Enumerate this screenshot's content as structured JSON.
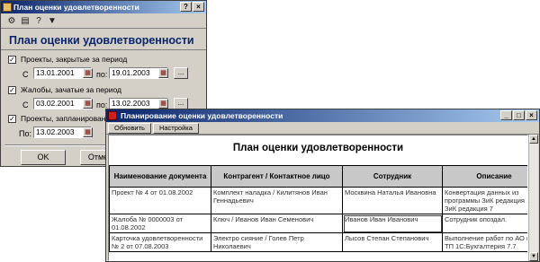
{
  "dialog": {
    "title": "План оценки удовлетворенности",
    "heading": "План оценки удовлетворенности",
    "toolbar_icons": [
      "tools-icon",
      "copy-icon",
      "help-icon",
      "filter-icon"
    ],
    "groups": [
      {
        "checked": true,
        "label": "Проекты, закрытые за период",
        "from_label": "С",
        "from": "13.01.2001",
        "to_label": "по:",
        "to": "19.01.2003"
      },
      {
        "checked": true,
        "label": "Жалобы, зачатые за период",
        "from_label": "С",
        "from": "03.02.2001",
        "to_label": "по:",
        "to": "13.02.2003"
      },
      {
        "checked": true,
        "label": "Проекты, запланированные",
        "from_label": "По:",
        "from": "13.02.2003"
      }
    ],
    "ok_label": "OK",
    "cancel_label": "Отмена"
  },
  "report_window": {
    "title": "Планирование оценки удовлетворенности",
    "toolbar": [
      "Обновить",
      "Настройка"
    ],
    "report_title": "План оценки удовлетворенности",
    "columns": [
      "Наименование документа",
      "Контрагент / Контактное лицо",
      "Сотрудник",
      "Описание"
    ],
    "rows": [
      [
        "Проект №     4 от 01.08.2002",
        "Комплект наладка / Килитянов Иван Геннадьевич",
        "Москвина Наталья Ивановна",
        "Конвертация данных из программы ЗиК редакция 1 в ЗиК редакция 7"
      ],
      [
        "Жалоба № 0000003 от 01.08.2002",
        "Ключ / Иванов Иван Семенович",
        "Иванов Иван Иванович",
        "Сотрудник опоздал."
      ],
      [
        "Карточка удовлетворенности №     2 от 07.08.2003",
        "Электро сияние / Голев Петр Николаевич",
        "Лысов Степан Степанович",
        "Выполнение работ по АО на ТП 1С:Бухгалтерия 7.7"
      ]
    ]
  }
}
